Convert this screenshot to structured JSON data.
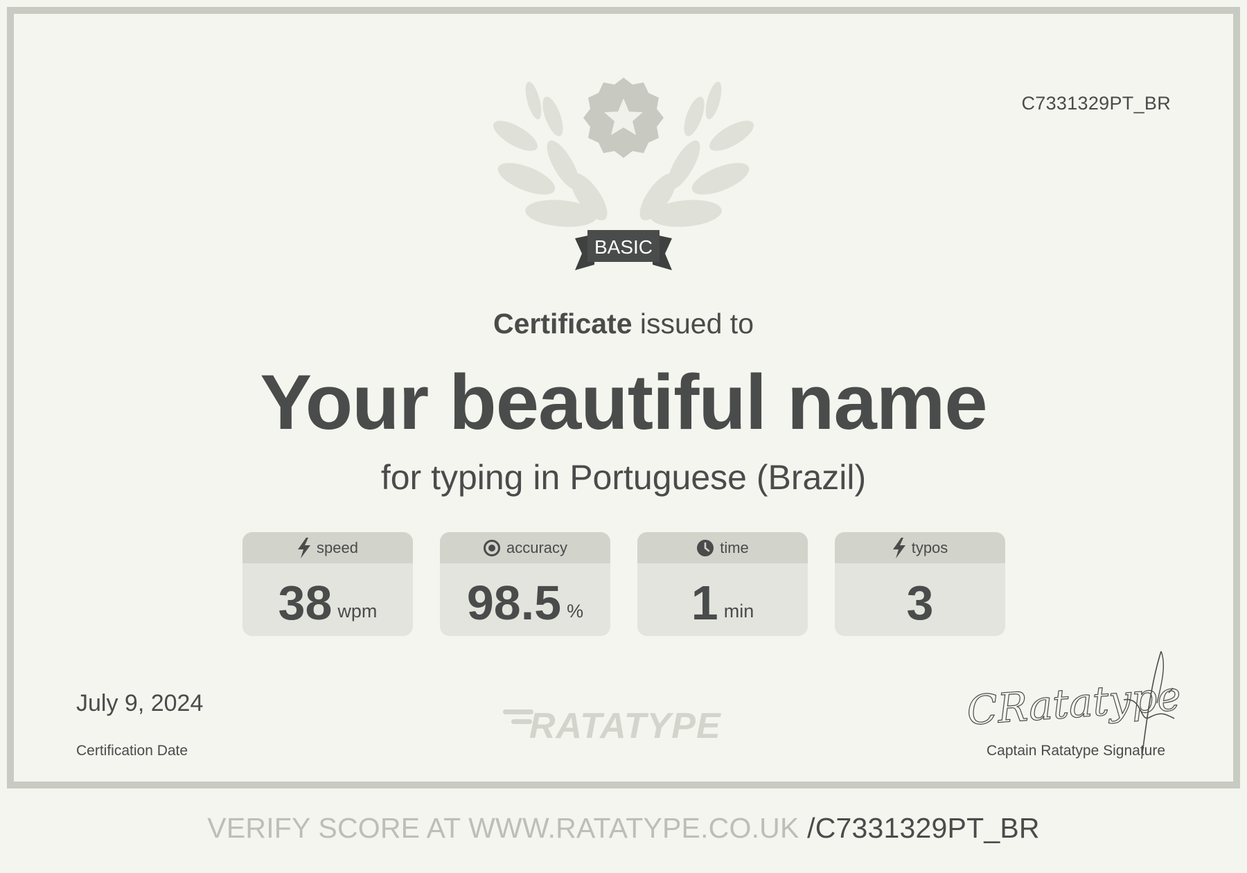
{
  "certificate": {
    "code": "C7331329PT_BR",
    "badge": "BASIC",
    "issued_strong": "Certificate",
    "issued_rest": " issued to",
    "name": "Your beautiful name",
    "for_line": "for typing in Portuguese (Brazil)",
    "stats": [
      {
        "icon": "lightning-icon",
        "label": "speed",
        "value": "38",
        "unit": "wpm"
      },
      {
        "icon": "target-icon",
        "label": "accuracy",
        "value": "98.5",
        "unit": "%"
      },
      {
        "icon": "clock-icon",
        "label": "time",
        "value": "1",
        "unit": "min"
      },
      {
        "icon": "lightning-icon",
        "label": "typos",
        "value": "3",
        "unit": ""
      }
    ],
    "date": "July 9, 2024",
    "date_label": "Certification Date",
    "logo_text": "RATATYPE",
    "signature_text": "CRatatype",
    "signature_label": "Captain Ratatype Signature"
  },
  "verify": {
    "prefix": "VERIFY SCORE AT WWW.RATATYPE.CO.UK ",
    "code": "/C7331329PT_BR"
  },
  "colors": {
    "background": "#f4f5ee",
    "frame": "#c9cac2",
    "text": "#4a4b4b",
    "stat_head": "#d2d3cb",
    "stat_body": "#e3e4dd",
    "muted": "#bdbeb7"
  }
}
